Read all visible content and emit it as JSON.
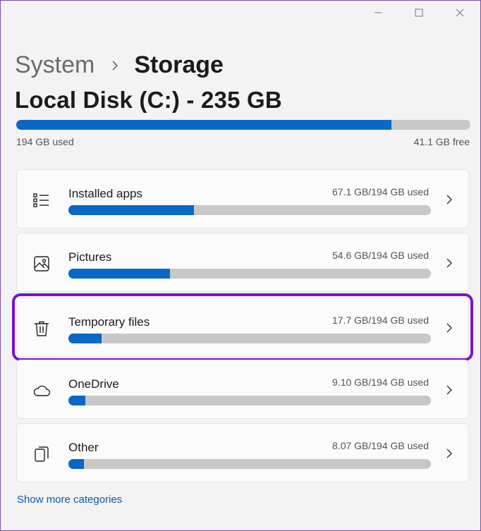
{
  "window": {
    "controls": [
      "minimize-icon",
      "maximize-icon",
      "close-icon"
    ]
  },
  "breadcrumb": {
    "parent": "System",
    "separator_icon": "chevron-right-icon",
    "current": "Storage"
  },
  "disk": {
    "title": "Local Disk (C:) - 235 GB",
    "used_label": "194 GB used",
    "free_label": "41.1 GB free",
    "used_fraction": 0.826
  },
  "categories": [
    {
      "label": "Installed apps",
      "usage": "67.1 GB/194 GB used",
      "fraction": 0.346,
      "icon": "list-icon"
    },
    {
      "label": "Pictures",
      "usage": "54.6 GB/194 GB used",
      "fraction": 0.281,
      "icon": "image-icon"
    },
    {
      "label": "Temporary files",
      "usage": "17.7 GB/194 GB used",
      "fraction": 0.091,
      "icon": "trash-icon",
      "highlighted": true
    },
    {
      "label": "OneDrive",
      "usage": "9.10 GB/194 GB used",
      "fraction": 0.047,
      "icon": "cloud-icon"
    },
    {
      "label": "Other",
      "usage": "8.07 GB/194 GB used",
      "fraction": 0.042,
      "icon": "files-icon"
    }
  ],
  "show_more": "Show more categories",
  "colors": {
    "accent": "#0967c6",
    "bar_track": "#c8c8c8",
    "highlight": "#7a14c8",
    "link": "#0a5aa8"
  }
}
